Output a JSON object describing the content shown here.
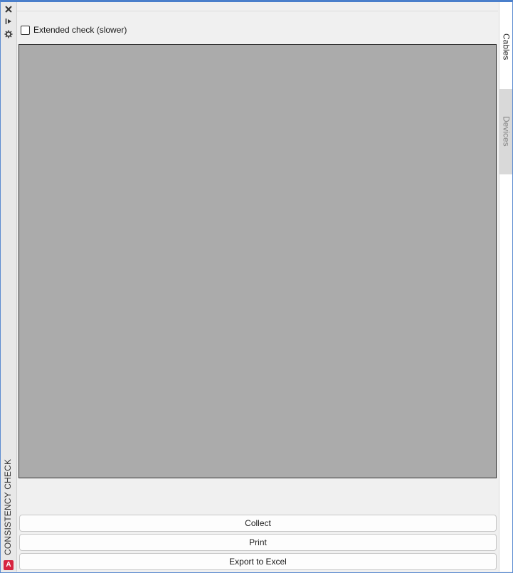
{
  "palette": {
    "title": "CONSISTENCY CHECK",
    "logo_letter": "A",
    "icons": [
      "close-icon",
      "auto-hide-icon",
      "properties-icon"
    ]
  },
  "options": {
    "extended_check_label": "Extended check (slower)",
    "extended_check_checked": false
  },
  "buttons": {
    "collect": "Collect",
    "print": "Print",
    "export": "Export to Excel"
  },
  "tabs": [
    {
      "label": "Cables",
      "active": true
    },
    {
      "label": "Devices",
      "active": false
    }
  ],
  "colors": {
    "accent_border": "#4a7fcb",
    "results_background": "#ababab",
    "logo": "#d6243f"
  }
}
